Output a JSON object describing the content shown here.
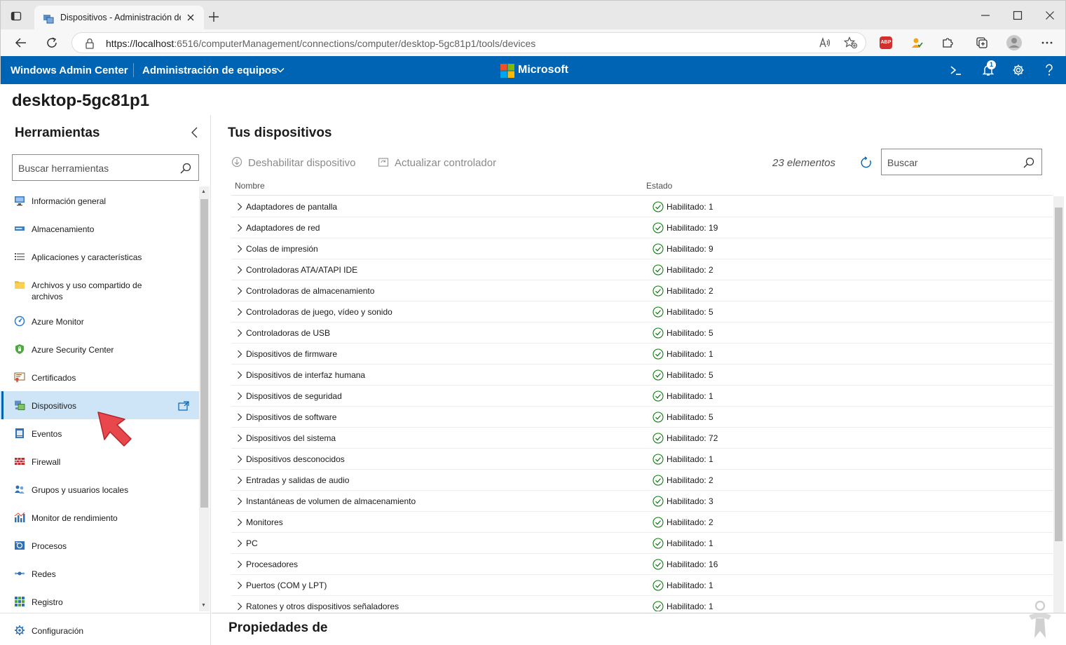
{
  "browser": {
    "tab_title": "Dispositivos - Administración de equipos",
    "url_host": "https://localhost",
    "url_rest": ":6516/computerManagement/connections/computer/desktop-5gc81p1/tools/devices",
    "abp_label": "ABP"
  },
  "header": {
    "brand": "Windows Admin Center",
    "solution": "Administración de equipos",
    "microsoft": "Microsoft",
    "notification_count": "1"
  },
  "computer_name": "desktop-5gc81p1",
  "sidebar": {
    "title": "Herramientas",
    "search_placeholder": "Buscar herramientas",
    "items": [
      {
        "label": "Información general",
        "icon": "overview-icon"
      },
      {
        "label": "Almacenamiento",
        "icon": "storage-icon"
      },
      {
        "label": "Aplicaciones y características",
        "icon": "apps-list-icon"
      },
      {
        "label": "Archivos y uso compartido de archivos",
        "icon": "folder-icon"
      },
      {
        "label": "Azure Monitor",
        "icon": "azure-monitor-icon"
      },
      {
        "label": "Azure Security Center",
        "icon": "shield-icon"
      },
      {
        "label": "Certificados",
        "icon": "certificate-icon"
      },
      {
        "label": "Dispositivos",
        "icon": "devices-icon"
      },
      {
        "label": "Eventos",
        "icon": "events-icon"
      },
      {
        "label": "Firewall",
        "icon": "firewall-icon"
      },
      {
        "label": "Grupos y usuarios locales",
        "icon": "users-icon"
      },
      {
        "label": "Monitor de rendimiento",
        "icon": "performance-icon"
      },
      {
        "label": "Procesos",
        "icon": "processes-icon"
      },
      {
        "label": "Redes",
        "icon": "network-icon"
      },
      {
        "label": "Registro",
        "icon": "registry-icon"
      }
    ],
    "active_item": "Dispositivos",
    "settings_label": "Configuración"
  },
  "main": {
    "title": "Tus dispositivos",
    "disable_label": "Deshabilitar dispositivo",
    "update_label": "Actualizar controlador",
    "count": "23 elementos",
    "search_placeholder": "Buscar",
    "columns": {
      "name": "Nombre",
      "state": "Estado"
    },
    "rows": [
      {
        "name": "Adaptadores de pantalla",
        "state": "Habilitado: 1"
      },
      {
        "name": "Adaptadores de red",
        "state": "Habilitado: 19"
      },
      {
        "name": "Colas de impresión",
        "state": "Habilitado: 9"
      },
      {
        "name": "Controladoras ATA/ATAPI IDE",
        "state": "Habilitado: 2"
      },
      {
        "name": "Controladoras de almacenamiento",
        "state": "Habilitado: 2"
      },
      {
        "name": "Controladoras de juego, vídeo y sonido",
        "state": "Habilitado: 5"
      },
      {
        "name": "Controladoras de USB",
        "state": "Habilitado: 5"
      },
      {
        "name": "Dispositivos de firmware",
        "state": "Habilitado: 1"
      },
      {
        "name": "Dispositivos de interfaz humana",
        "state": "Habilitado: 5"
      },
      {
        "name": "Dispositivos de seguridad",
        "state": "Habilitado: 1"
      },
      {
        "name": "Dispositivos de software",
        "state": "Habilitado: 5"
      },
      {
        "name": "Dispositivos del sistema",
        "state": "Habilitado: 72"
      },
      {
        "name": "Dispositivos desconocidos",
        "state": "Habilitado: 1"
      },
      {
        "name": "Entradas y salidas de audio",
        "state": "Habilitado: 2"
      },
      {
        "name": "Instantáneas de volumen de almacenamiento",
        "state": "Habilitado: 3"
      },
      {
        "name": "Monitores",
        "state": "Habilitado: 2"
      },
      {
        "name": "PC",
        "state": "Habilitado: 1"
      },
      {
        "name": "Procesadores",
        "state": "Habilitado: 16"
      },
      {
        "name": "Puertos (COM y LPT)",
        "state": "Habilitado: 1"
      },
      {
        "name": "Ratones y otros dispositivos señaladores",
        "state": "Habilitado: 1"
      }
    ],
    "properties_title": "Propiedades de"
  },
  "colors": {
    "accent": "#0064b4",
    "active_bg": "#cde5f7",
    "ok_green": "#107c10",
    "arrow_red": "#e8474c"
  }
}
